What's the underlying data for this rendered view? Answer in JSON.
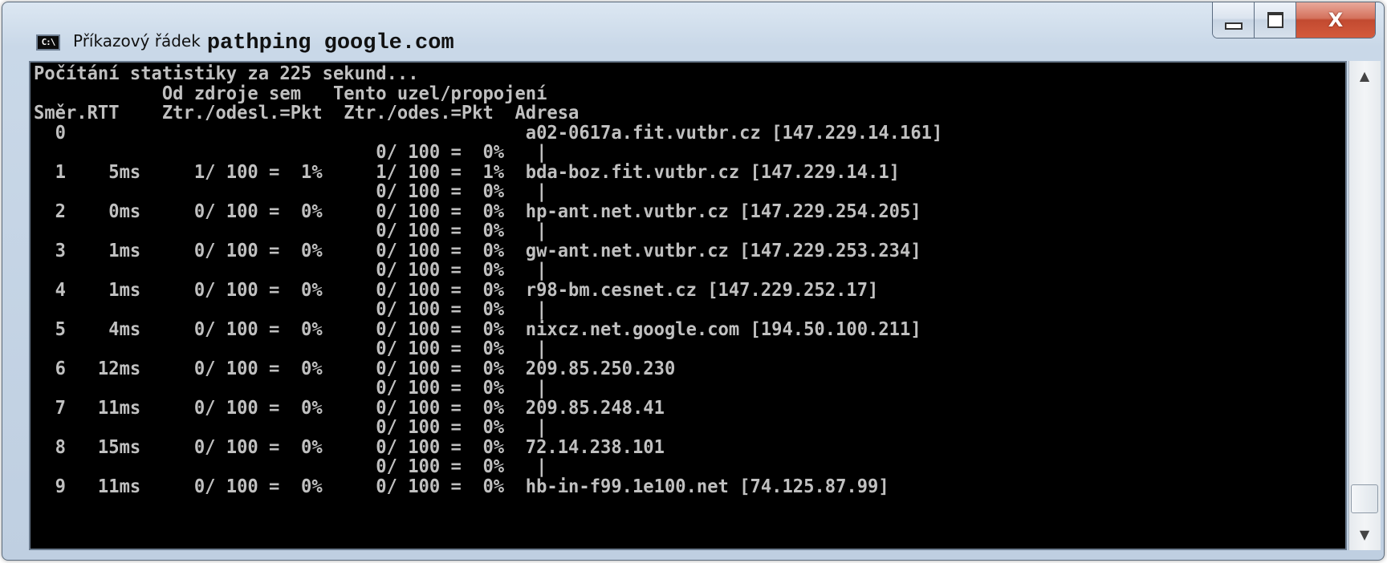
{
  "window": {
    "title": "Příkazový řádek",
    "command": "pathping google.com",
    "icon": "cmd-icon",
    "icon_label": "C:\\"
  },
  "controls": {
    "minimize": "minimize-icon",
    "maximize": "maximize-icon",
    "close": "close-icon",
    "close_glyph": "X"
  },
  "console": {
    "background": "#000000",
    "text_color": "#c0c0c0",
    "lines": [
      "Počítání statistiky za 225 sekund...",
      "            Od zdroje sem   Tento uzel/propojení",
      "Směr.RTT    Ztr./odesl.=Pkt  Ztr./odes.=Pkt  Adresa",
      "  0                                           a02-0617a.fit.vutbr.cz [147.229.14.161]",
      "                                0/ 100 =  0%   |",
      "  1    5ms     1/ 100 =  1%     1/ 100 =  1%  bda-boz.fit.vutbr.cz [147.229.14.1]",
      "                                0/ 100 =  0%   |",
      "  2    0ms     0/ 100 =  0%     0/ 100 =  0%  hp-ant.net.vutbr.cz [147.229.254.205]",
      "                                0/ 100 =  0%   |",
      "  3    1ms     0/ 100 =  0%     0/ 100 =  0%  gw-ant.net.vutbr.cz [147.229.253.234]",
      "                                0/ 100 =  0%   |",
      "  4    1ms     0/ 100 =  0%     0/ 100 =  0%  r98-bm.cesnet.cz [147.229.252.17]",
      "                                0/ 100 =  0%   |",
      "  5    4ms     0/ 100 =  0%     0/ 100 =  0%  nixcz.net.google.com [194.50.100.211]",
      "                                0/ 100 =  0%   |",
      "  6   12ms     0/ 100 =  0%     0/ 100 =  0%  209.85.250.230",
      "                                0/ 100 =  0%   |",
      "  7   11ms     0/ 100 =  0%     0/ 100 =  0%  209.85.248.41",
      "                                0/ 100 =  0%   |",
      "  8   15ms     0/ 100 =  0%     0/ 100 =  0%  72.14.238.101",
      "                                0/ 100 =  0%   |",
      "  9   11ms     0/ 100 =  0%     0/ 100 =  0%  hb-in-f99.1e100.net [74.125.87.99]"
    ]
  },
  "scrollbar": {
    "up": "▲",
    "down": "▼"
  }
}
